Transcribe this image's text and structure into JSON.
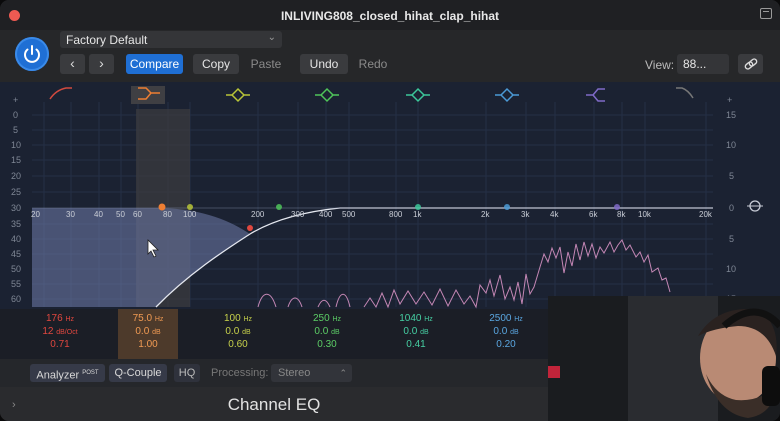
{
  "window": {
    "title": "INLIVING808_closed_hihat_clap_hihat"
  },
  "header": {
    "preset": "Factory Default",
    "compare": "Compare",
    "copy": "Copy",
    "paste": "Paste",
    "undo": "Undo",
    "redo": "Redo",
    "view_label": "View:",
    "view_value": "88..."
  },
  "eq": {
    "db_scale_left": [
      "+",
      "0",
      "5",
      "10",
      "15",
      "20",
      "25",
      "30",
      "35",
      "40",
      "45",
      "50",
      "55",
      "60"
    ],
    "db_scale_right": [
      "+",
      "15",
      "10",
      "5",
      "0",
      "5",
      "10",
      "15"
    ],
    "freq_labels": [
      "20",
      "30",
      "40",
      "50",
      "60",
      "80",
      "100",
      "200",
      "300",
      "400",
      "500",
      "800",
      "1k",
      "2k",
      "3k",
      "4k",
      "6k",
      "8k",
      "10k",
      "20k"
    ],
    "bands": [
      {
        "freq": "176",
        "freq_unit": "Hz",
        "gain": "12",
        "gain_unit": "dB/Oct",
        "q": "0.71",
        "color": "#e0473f"
      },
      {
        "freq": "75.0",
        "freq_unit": "Hz",
        "gain": "0.0",
        "gain_unit": "dB",
        "q": "1.00",
        "color": "#ee7e33"
      },
      {
        "freq": "100",
        "freq_unit": "Hz",
        "gain": "0.0",
        "gain_unit": "dB",
        "q": "0.60",
        "color": "#b9c538"
      },
      {
        "freq": "250",
        "freq_unit": "Hz",
        "gain": "0.0",
        "gain_unit": "dB",
        "q": "0.30",
        "color": "#4fc45a"
      },
      {
        "freq": "1040",
        "freq_unit": "Hz",
        "gain": "0.0",
        "gain_unit": "dB",
        "q": "0.41",
        "color": "#3cc79a"
      },
      {
        "freq": "2500",
        "freq_unit": "Hz",
        "gain": "0.0",
        "gain_unit": "dB",
        "q": "0.20",
        "color": "#4b9ad6"
      }
    ]
  },
  "bottom": {
    "analyzer": "Analyzer",
    "analyzer_sup": "POST",
    "qcouple": "Q-Couple",
    "hq": "HQ",
    "processing_label": "Processing:",
    "processing_value": "Stereo"
  },
  "footer": {
    "plugin_name": "Channel EQ"
  }
}
